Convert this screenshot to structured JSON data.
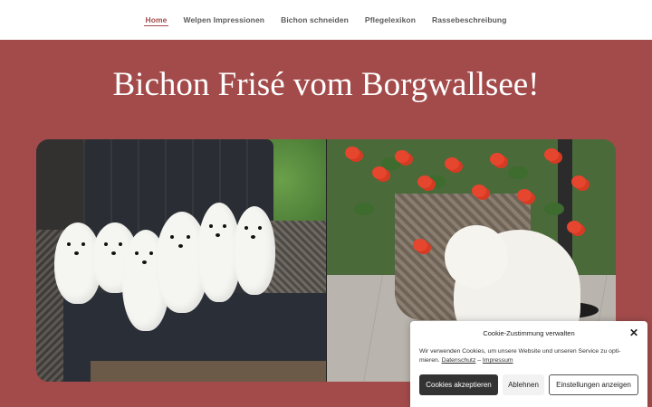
{
  "nav": {
    "items": [
      {
        "label": "Home",
        "active": true
      },
      {
        "label": "Welpen Impressionen",
        "active": false
      },
      {
        "label": "Bichon schneiden",
        "active": false
      },
      {
        "label": "Pflegelexikon",
        "active": false
      },
      {
        "label": "Rassebeschreibung",
        "active": false
      }
    ]
  },
  "hero": {
    "title": "Bichon Frisé vom Borgwallsee!"
  },
  "cookie_banner": {
    "title": "Cookie-Zustimmung verwalten",
    "close_icon": "close-icon",
    "text": "Wir verwenden Cookies, um unsere Website und unseren Service zu opti-mieren.",
    "link_privacy": "Datenschutz",
    "separator": "–",
    "link_imprint": "Impressum",
    "accept_label": "Cookies akzeptieren",
    "deny_label": "Ablehnen",
    "settings_label": "Einstellungen anzeigen"
  },
  "colors": {
    "accent": "#a34b4b",
    "nav_bg": "#ffffff",
    "accept_bg": "#333333"
  }
}
